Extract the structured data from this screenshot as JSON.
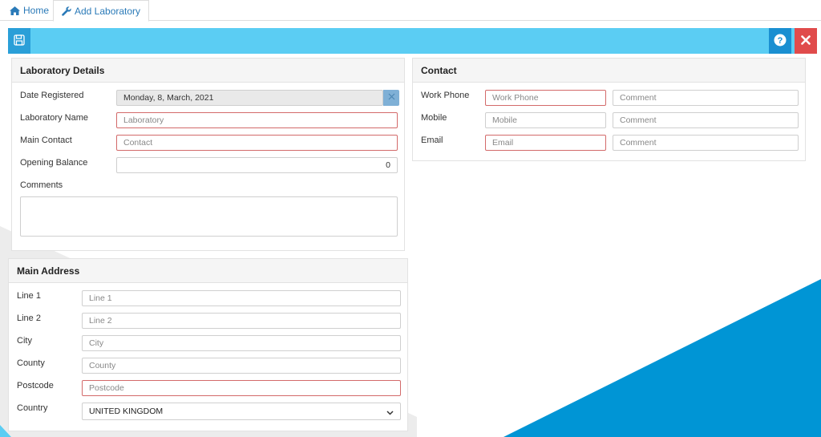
{
  "tabs": {
    "home_label": "Home",
    "add_lab_label": "Add Laboratory"
  },
  "toolbar": {
    "save_icon": "save-icon",
    "help_icon": "question-circle-icon",
    "close_icon": "close-icon"
  },
  "lab_details": {
    "title": "Laboratory Details",
    "date_label": "Date Registered",
    "date_value": "Monday, 8, March, 2021",
    "name_label": "Laboratory Name",
    "name_placeholder": "Laboratory",
    "contact_label": "Main Contact",
    "contact_placeholder": "Contact",
    "balance_label": "Opening Balance",
    "balance_value": "0",
    "comments_label": "Comments",
    "comments_value": ""
  },
  "main_address": {
    "title": "Main Address",
    "line1_label": "Line 1",
    "line1_placeholder": "Line 1",
    "line2_label": "Line 2",
    "line2_placeholder": "Line 2",
    "city_label": "City",
    "city_placeholder": "City",
    "county_label": "County",
    "county_placeholder": "County",
    "postcode_label": "Postcode",
    "postcode_placeholder": "Postcode",
    "country_label": "Country",
    "country_value": "UNITED KINGDOM"
  },
  "contact": {
    "title": "Contact",
    "work_label": "Work Phone",
    "work_placeholder": "Work Phone",
    "mobile_label": "Mobile",
    "mobile_placeholder": "Mobile",
    "email_label": "Email",
    "email_placeholder": "Email",
    "comment_placeholder": "Comment"
  },
  "colors": {
    "toolbar": "#5bcdf3",
    "save_button": "#2a9fd8",
    "help_button": "#1a8fd1",
    "close_button": "#e04b4b",
    "link": "#2a7ab8",
    "required_border": "#d36a6a",
    "background_shape": "#0095d5"
  }
}
